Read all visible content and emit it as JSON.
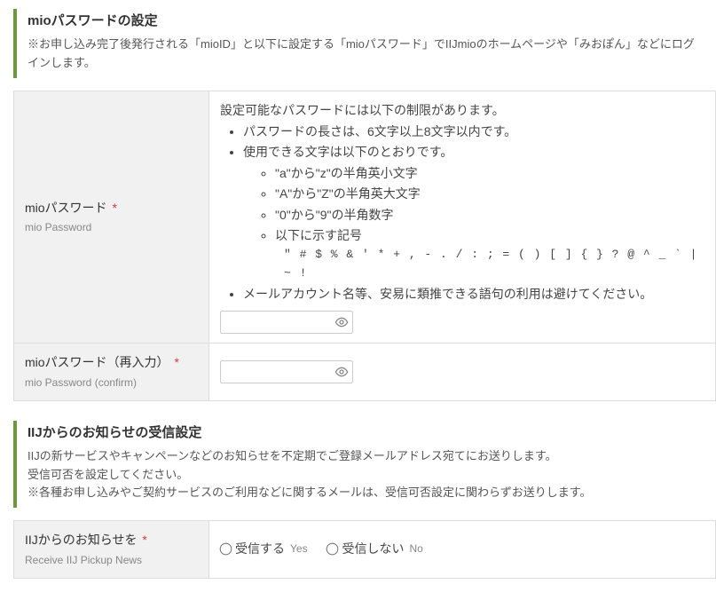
{
  "section1": {
    "title": "mioパスワードの設定",
    "desc": "※お申し込み完了後発行される「mioID」と以下に設定する「mioパスワード」でIIJmioのホームページや「みおぽん」などにログインします。"
  },
  "password_row": {
    "label": "mioパスワード",
    "label_sub": "mio Password",
    "required_mark": "*",
    "rules_intro": "設定可能なパスワードには以下の制限があります。",
    "rule_len": "パスワードの長さは、6文字以上8文字以内です。",
    "rule_chars_intro": "使用できる文字は以下のとおりです。",
    "rule_lower": "\"a\"から\"z\"の半角英小文字",
    "rule_upper": "\"A\"から\"Z\"の半角英大文字",
    "rule_digit": "\"0\"から\"9\"の半角数字",
    "rule_sym_intro": "以下に示す記号",
    "rule_sym": "\" # $ % & ' * + , - . / : ; = ( ) [ ] { } ? @ ^ _ ` | ~ !",
    "rule_easy": "メールアカウント名等、安易に類推できる語句の利用は避けてください。"
  },
  "password_confirm_row": {
    "label": "mioパスワード（再入力）",
    "label_sub": "mio Password (confirm)",
    "required_mark": "*"
  },
  "section2": {
    "title": "IIJからのお知らせの受信設定",
    "desc1": "IIJの新サービスやキャンペーンなどのお知らせを不定期でご登録メールアドレス宛てにお送りします。",
    "desc2": "受信可否を設定してください。",
    "desc3": "※各種お申し込みやご契約サービスのご利用などに関するメールは、受信可否設定に関わらずお送りします。"
  },
  "news_row": {
    "label": "IIJからのお知らせを",
    "label_sub": "Receive IIJ Pickup News",
    "required_mark": "*",
    "opt_yes": "受信する",
    "opt_yes_sub": "Yes",
    "opt_no": "受信しない",
    "opt_no_sub": "No"
  }
}
